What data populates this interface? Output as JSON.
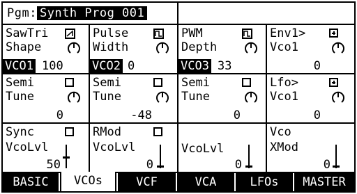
{
  "title": {
    "label": "Pgm:",
    "name": "Synth Prog 001"
  },
  "rows": [
    [
      {
        "line1": "SawTri",
        "line2": "Shape",
        "tag": "VCO1",
        "value": "100",
        "icon": "waveform-saw-icon",
        "control": "knob"
      },
      {
        "line1": "Pulse",
        "line2": "Width",
        "tag": "VCO2",
        "value": "0",
        "icon": "waveform-pulse-icon",
        "control": "knob"
      },
      {
        "line1": "PWM",
        "line2": "Depth",
        "tag": "VCO3",
        "value": "33",
        "icon": "waveform-pulse-icon",
        "control": "knob"
      },
      {
        "line1": "Env1>",
        "line2": "Vco1",
        "tag": "",
        "value": "0",
        "icon": "plus-box-icon",
        "control": "knob"
      }
    ],
    [
      {
        "line1": "Semi",
        "line2": "Tune",
        "value": "0",
        "icon": "checkbox-icon",
        "control": "knob"
      },
      {
        "line1": "Semi",
        "line2": "Tune",
        "value": "-48",
        "icon": "checkbox-icon",
        "control": "knob"
      },
      {
        "line1": "Semi",
        "line2": "Tune",
        "value": "0",
        "icon": "checkbox-icon",
        "control": "knob"
      },
      {
        "line1": "Lfo>",
        "line2": "Vco1",
        "value": "0",
        "icon": "plus-box-icon",
        "control": "knob"
      }
    ],
    [
      {
        "line1": "Sync",
        "line2": "VcoLvl",
        "value": "50",
        "icon": "checkbox-icon",
        "control": "slider"
      },
      {
        "line1": "RMod",
        "line2": "VcoLvl",
        "value": "0",
        "icon": "checkbox-icon",
        "control": "slider"
      },
      {
        "line1": "",
        "line2": "VcoLvl",
        "value": "0",
        "icon": "",
        "control": "slider"
      },
      {
        "line1": "Vco",
        "line2": "XMod",
        "value": "0",
        "icon": "",
        "control": "slider"
      }
    ]
  ],
  "tabs": [
    {
      "label": "BASIC",
      "active": false
    },
    {
      "label": "VCOs",
      "active": true
    },
    {
      "label": "VCF",
      "active": false
    },
    {
      "label": "VCA",
      "active": false
    },
    {
      "label": "LFOs",
      "active": false
    },
    {
      "label": "MASTER",
      "active": false
    }
  ],
  "colors": {
    "fg": "#000000",
    "bg": "#ffffff"
  }
}
